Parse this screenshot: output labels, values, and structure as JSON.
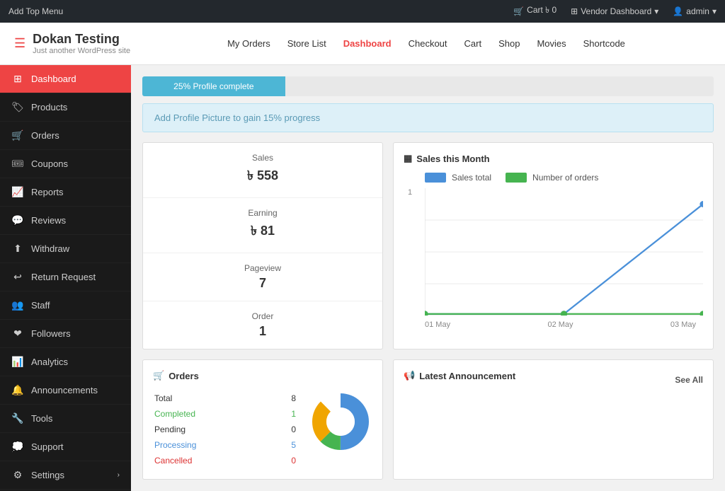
{
  "adminBar": {
    "addTopMenu": "Add Top Menu",
    "cart": "Cart ৳ 0",
    "vendorDashboard": "Vendor Dashboard",
    "admin": "admin"
  },
  "header": {
    "logo": "Dokan Testing",
    "tagline": "Just another WordPress site",
    "nav": [
      {
        "label": "My Orders",
        "active": false
      },
      {
        "label": "Store List",
        "active": false
      },
      {
        "label": "Dashboard",
        "active": true
      },
      {
        "label": "Checkout",
        "active": false
      },
      {
        "label": "Cart",
        "active": false
      },
      {
        "label": "Shop",
        "active": false
      },
      {
        "label": "Movies",
        "active": false
      },
      {
        "label": "Shortcode",
        "active": false
      }
    ]
  },
  "sidebar": {
    "items": [
      {
        "label": "Dashboard",
        "icon": "dashboard",
        "active": true
      },
      {
        "label": "Products",
        "icon": "products",
        "active": false
      },
      {
        "label": "Orders",
        "icon": "orders",
        "active": false
      },
      {
        "label": "Coupons",
        "icon": "coupons",
        "active": false
      },
      {
        "label": "Reports",
        "icon": "reports",
        "active": false
      },
      {
        "label": "Reviews",
        "icon": "reviews",
        "active": false
      },
      {
        "label": "Withdraw",
        "icon": "withdraw",
        "active": false
      },
      {
        "label": "Return Request",
        "icon": "return",
        "active": false
      },
      {
        "label": "Staff",
        "icon": "staff",
        "active": false
      },
      {
        "label": "Followers",
        "icon": "followers",
        "active": false
      },
      {
        "label": "Analytics",
        "icon": "analytics",
        "active": false
      },
      {
        "label": "Announcements",
        "icon": "announcements",
        "active": false
      },
      {
        "label": "Tools",
        "icon": "tools",
        "active": false
      },
      {
        "label": "Support",
        "icon": "support",
        "active": false
      },
      {
        "label": "Settings",
        "icon": "settings",
        "active": false,
        "hasChevron": true
      }
    ]
  },
  "main": {
    "profileProgress": {
      "percent": 25,
      "label": "25% Profile complete"
    },
    "profileAlert": "Add Profile Picture to gain 15% progress",
    "stats": [
      {
        "label": "Sales",
        "value": "৳ 558"
      },
      {
        "label": "Earning",
        "value": "৳ 81"
      },
      {
        "label": "Pageview",
        "value": "7"
      },
      {
        "label": "Order",
        "value": "1"
      }
    ],
    "salesChart": {
      "title": "Sales this Month",
      "legend": [
        {
          "label": "Sales total",
          "color": "#4a90d9"
        },
        {
          "label": "Number of orders",
          "color": "#46b450"
        }
      ],
      "yLabel": "1",
      "xLabels": [
        "01 May",
        "02 May",
        "03 May"
      ],
      "lineColor1": "#4a90d9",
      "lineColor2": "#46b450"
    },
    "orders": {
      "title": "Orders",
      "rows": [
        {
          "label": "Total",
          "value": "8",
          "color": "normal"
        },
        {
          "label": "Completed",
          "value": "1",
          "color": "green"
        },
        {
          "label": "Pending",
          "value": "0",
          "color": "normal"
        },
        {
          "label": "Processing",
          "value": "5",
          "color": "blue"
        },
        {
          "label": "Cancelled",
          "value": "0",
          "color": "red"
        }
      ]
    },
    "latestAnnouncement": {
      "title": "Latest Announcement",
      "seeAll": "See All"
    }
  }
}
